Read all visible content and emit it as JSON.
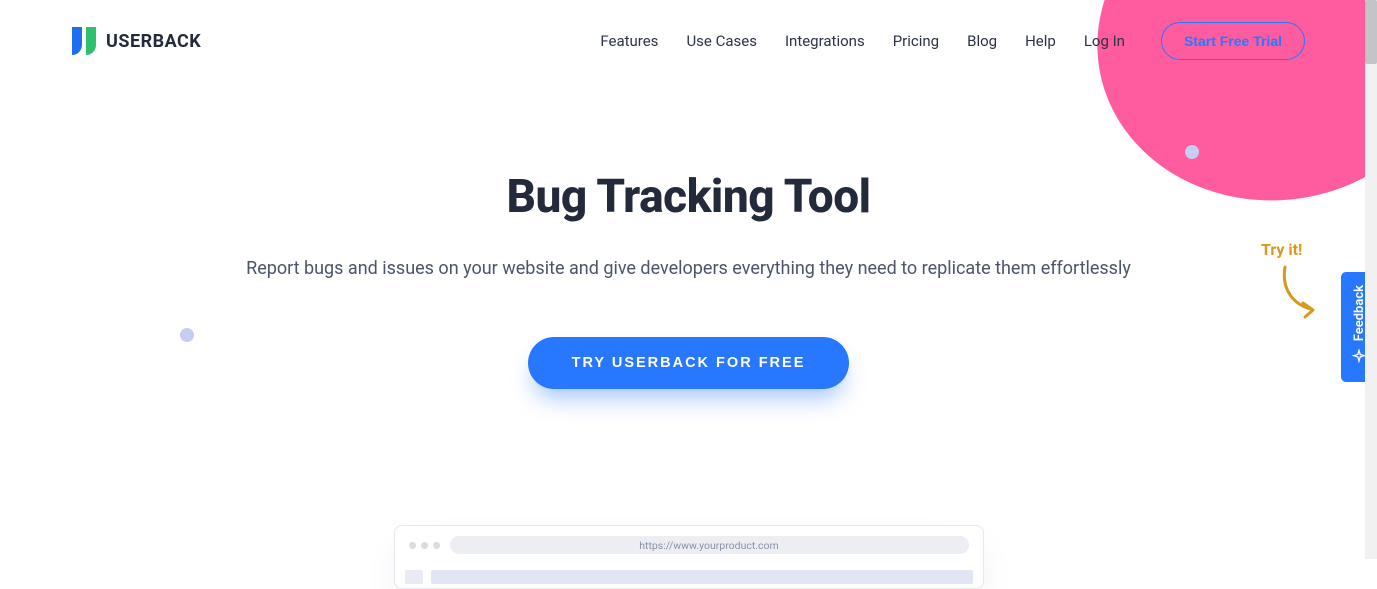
{
  "brand": {
    "name": "USERBACK"
  },
  "nav": {
    "items": [
      {
        "label": "Features"
      },
      {
        "label": "Use Cases"
      },
      {
        "label": "Integrations"
      },
      {
        "label": "Pricing"
      },
      {
        "label": "Blog"
      },
      {
        "label": "Help"
      },
      {
        "label": "Log In"
      }
    ],
    "trial_label": "Start Free Trial"
  },
  "hero": {
    "title": "Bug Tracking Tool",
    "subtitle": "Report bugs and issues on your website and give developers everything they need to replicate them effortlessly",
    "cta_label": "TRY USERBACK FOR FREE"
  },
  "tryit": {
    "label": "Try it!"
  },
  "feedback_tab": {
    "label": "Feedback"
  },
  "browser_mock": {
    "url": "https://www.yourproduct.com"
  },
  "colors": {
    "primary": "#2877ff",
    "accent_pink": "#ff5ca0",
    "accent_lavender": "#c7cdf0",
    "text_dark": "#232b3a",
    "text_muted": "#4c5468",
    "tryit": "#d89a1a"
  }
}
